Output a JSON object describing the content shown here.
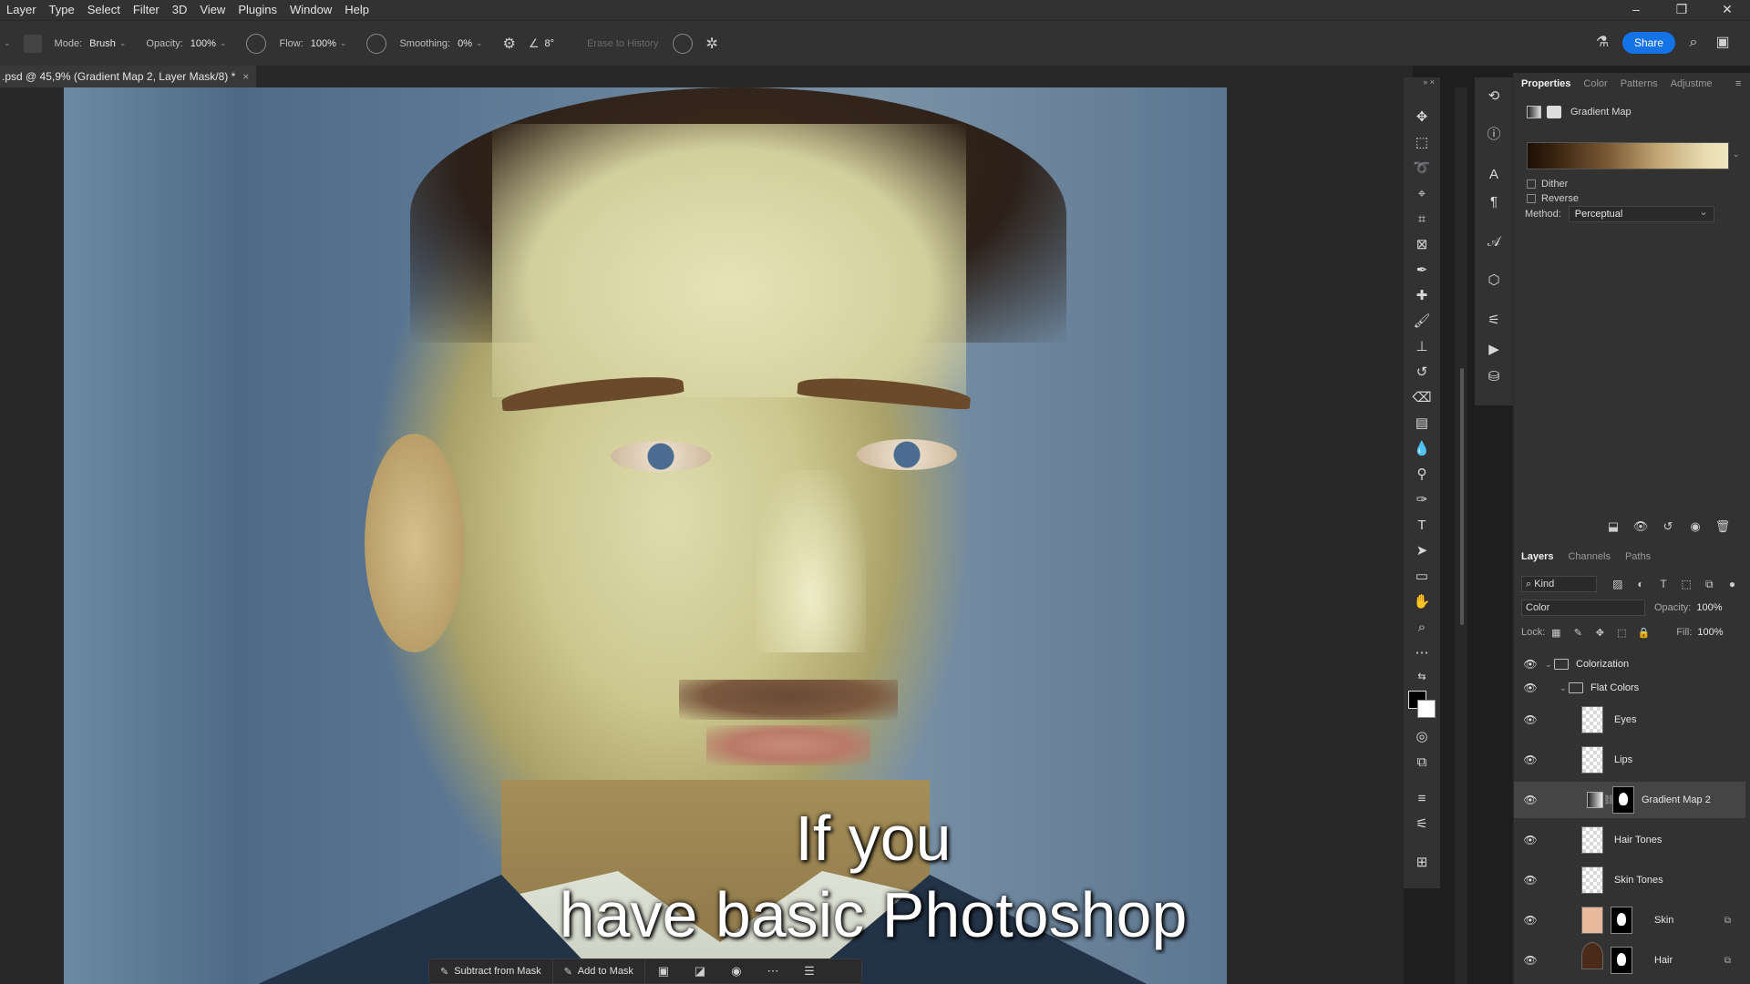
{
  "menu": [
    "Layer",
    "Type",
    "Select",
    "Filter",
    "3D",
    "View",
    "Plugins",
    "Window",
    "Help"
  ],
  "options_bar": {
    "mode_label": "Mode:",
    "mode_value": "Brush",
    "opacity_label": "Opacity:",
    "opacity_value": "100%",
    "flow_label": "Flow:",
    "flow_value": "100%",
    "smoothing_label": "Smoothing:",
    "smoothing_value": "0%",
    "angle_value": "8°",
    "erase_history": "Erase to History",
    "share_label": "Share"
  },
  "document_tab": {
    "title": ".psd @ 45,9% (Gradient Map 2, Layer Mask/8) *",
    "close": "×"
  },
  "caption": {
    "line1": "If you",
    "line2": "have basic Photoshop"
  },
  "task_bar": {
    "subtract": "Subtract from Mask",
    "add": "Add to Mask"
  },
  "properties": {
    "tabs": [
      "Properties",
      "Color",
      "Patterns",
      "Adjustme"
    ],
    "adjustment_name": "Gradient Map",
    "gradient_colors": [
      "#1c1006",
      "#7a5a34",
      "#eee6c2"
    ],
    "dither_label": "Dither",
    "reverse_label": "Reverse",
    "method_label": "Method:",
    "method_value": "Perceptual"
  },
  "layers_panel": {
    "tabs": [
      "Layers",
      "Channels",
      "Paths"
    ],
    "kind_label": "Kind",
    "blend_mode": "Color",
    "opacity_label": "Opacity:",
    "opacity_value": "100%",
    "lock_label": "Lock:",
    "fill_label": "Fill:",
    "fill_value": "100%",
    "layers": [
      {
        "name": "Colorization",
        "type": "group",
        "visible": true
      },
      {
        "name": "Flat Colors",
        "type": "group",
        "visible": true
      },
      {
        "name": "Eyes",
        "type": "pixel",
        "visible": true
      },
      {
        "name": "Lips",
        "type": "pixel",
        "visible": true
      },
      {
        "name": "Gradient Map 2",
        "type": "adjustment",
        "visible": true,
        "selected": true
      },
      {
        "name": "Hair Tones",
        "type": "pixel",
        "visible": true
      },
      {
        "name": "Skin Tones",
        "type": "pixel",
        "visible": true
      },
      {
        "name": "Skin",
        "type": "fill-mask",
        "visible": true
      },
      {
        "name": "Hair",
        "type": "fill-mask",
        "visible": true
      }
    ]
  },
  "window_controls": {
    "minimize": "–",
    "restore": "❐",
    "close": "✕"
  }
}
